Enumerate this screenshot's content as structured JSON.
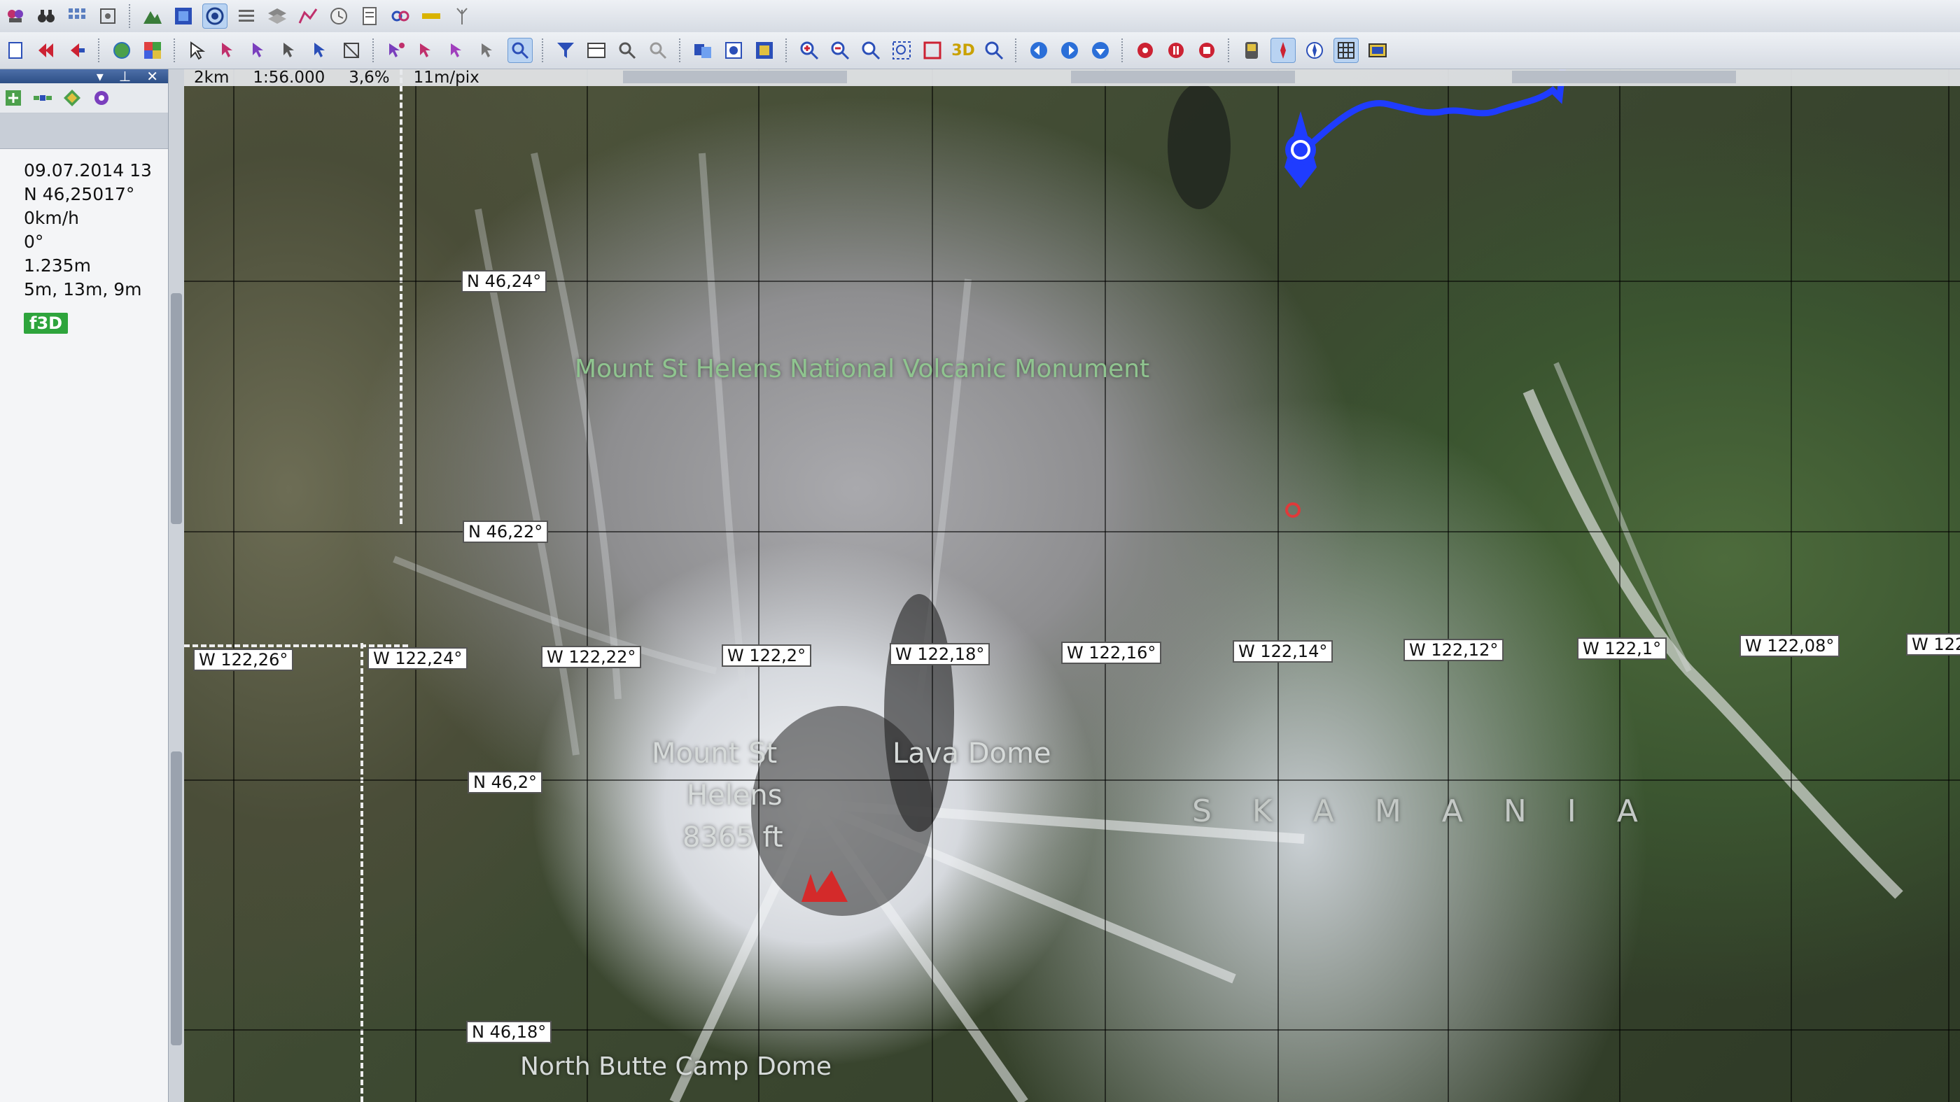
{
  "toolbar_top": {
    "icons": [
      "waypoint-icon",
      "binoculars-icon",
      "grid-select-icon",
      "gps-icon",
      "mountain-icon",
      "map-layer-icon",
      "target-icon",
      "list-icon",
      "layers-icon",
      "route-edit-icon",
      "clock-icon",
      "document-icon",
      "link-icon",
      "ruler-icon",
      "antenna-icon"
    ]
  },
  "toolbar_second": {
    "three_d_label": "3D"
  },
  "scale_bar": {
    "distance": "2km",
    "scale": "1:56.000",
    "zoom_percent": "3,6%",
    "resolution": "11m/pix"
  },
  "side_panel": {
    "date": "09.07.2014 13",
    "latitude": "N 46,25017°",
    "speed": "0km/h",
    "heading": "0°",
    "altitude": "1.235m",
    "accuracy": "5m, 13m, 9m",
    "badge": "f3D"
  },
  "map": {
    "latitude_labels": [
      "N 46,24°",
      "N 46,22°",
      "N 46,2°",
      "N 46,18°"
    ],
    "longitude_labels": [
      "W 122,26°",
      "W 122,24°",
      "W 122,22°",
      "W 122,2°",
      "W 122,18°",
      "W 122,16°",
      "W 122,14°",
      "W 122,12°",
      "W 122,1°",
      "W 122,08°",
      "W 122"
    ],
    "monument_label": "Mount St Helens National Volcanic Monument",
    "peak_name_line1": "Mount St",
    "peak_name_line2": "Helens",
    "peak_elevation": "8365 ft",
    "lava_dome_label": "Lava Dome",
    "county_label": "S K A M A N I A",
    "north_butte_label": "North Butte Camp Dome",
    "colors": {
      "track": "#1f3cff",
      "peak_marker": "#d42a2a",
      "grid": "#111111"
    }
  }
}
